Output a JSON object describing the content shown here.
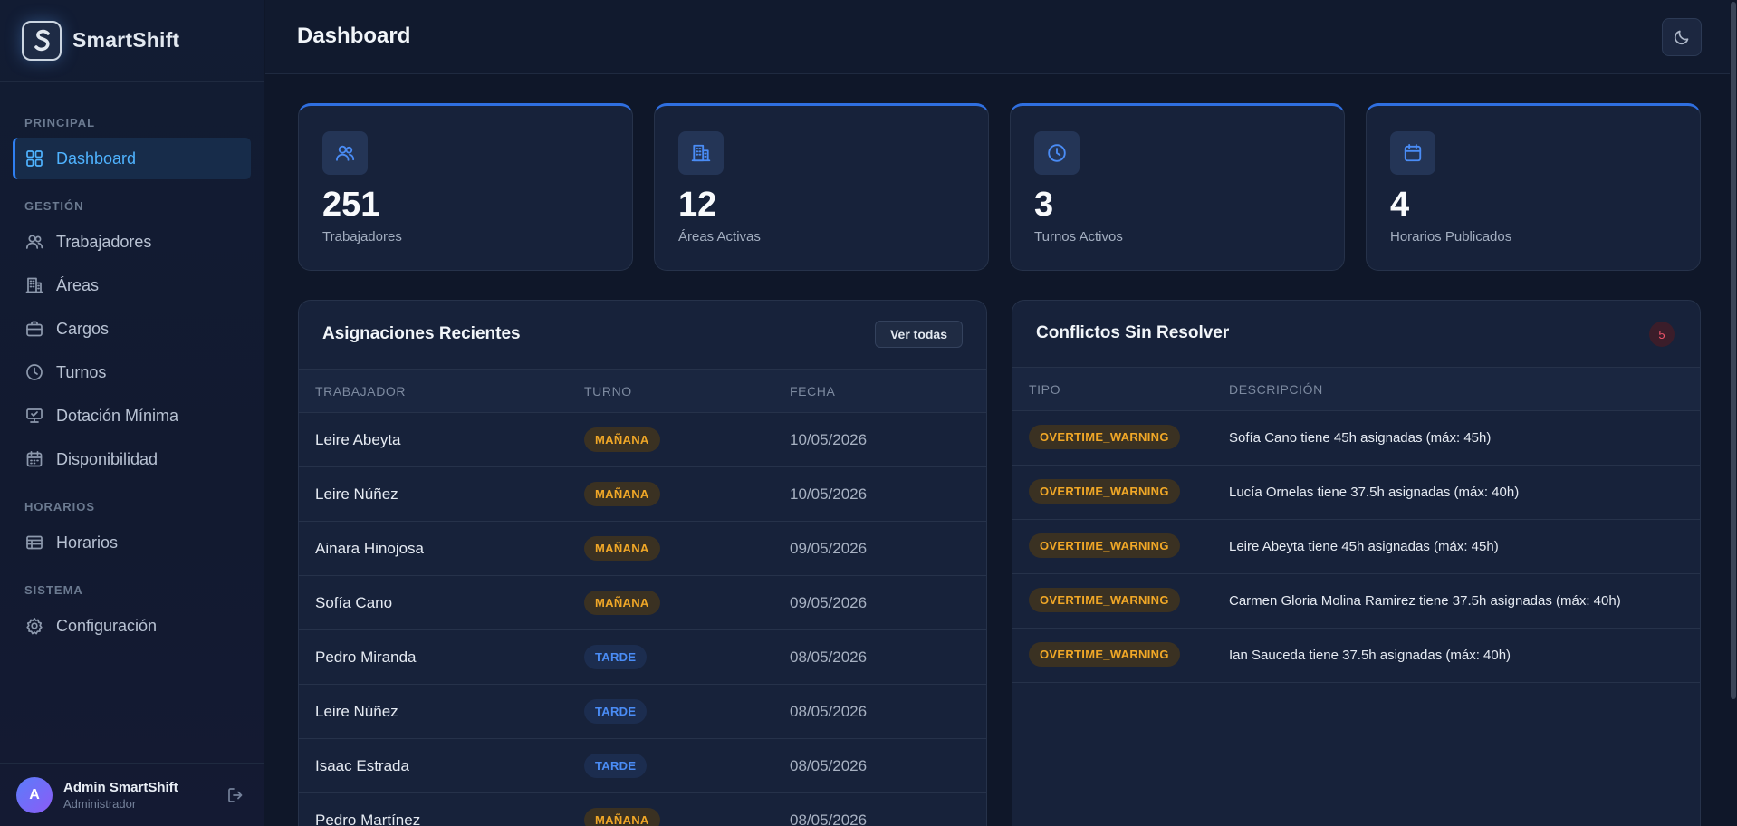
{
  "brand": {
    "name": "SmartShift"
  },
  "sidebar": {
    "sections": [
      {
        "title": "PRINCIPAL",
        "items": [
          {
            "label": "Dashboard",
            "icon": "grid-icon",
            "active": true
          }
        ]
      },
      {
        "title": "GESTIÓN",
        "items": [
          {
            "label": "Trabajadores",
            "icon": "users-icon"
          },
          {
            "label": "Áreas",
            "icon": "building-icon"
          },
          {
            "label": "Cargos",
            "icon": "briefcase-icon"
          },
          {
            "label": "Turnos",
            "icon": "clock-icon"
          },
          {
            "label": "Dotación Mínima",
            "icon": "user-check-icon"
          },
          {
            "label": "Disponibilidad",
            "icon": "calendar-icon"
          }
        ]
      },
      {
        "title": "HORARIOS",
        "items": [
          {
            "label": "Horarios",
            "icon": "table-icon"
          }
        ]
      },
      {
        "title": "SISTEMA",
        "items": [
          {
            "label": "Configuración",
            "icon": "gear-icon"
          }
        ]
      }
    ],
    "user": {
      "initial": "A",
      "name": "Admin SmartShift",
      "role": "Administrador"
    }
  },
  "header": {
    "title": "Dashboard"
  },
  "stats": [
    {
      "value": "251",
      "label": "Trabajadores",
      "icon": "users-icon"
    },
    {
      "value": "12",
      "label": "Áreas Activas",
      "icon": "building-icon"
    },
    {
      "value": "3",
      "label": "Turnos Activos",
      "icon": "clock-icon"
    },
    {
      "value": "4",
      "label": "Horarios Publicados",
      "icon": "calendar-icon"
    }
  ],
  "assignments": {
    "title": "Asignaciones Recientes",
    "button": "Ver todas",
    "columns": [
      "TRABAJADOR",
      "TURNO",
      "FECHA"
    ],
    "rows": [
      {
        "worker": "Leire Abeyta",
        "shift": "MAÑANA",
        "shift_type": "manana",
        "date": "10/05/2026"
      },
      {
        "worker": "Leire Núñez",
        "shift": "MAÑANA",
        "shift_type": "manana",
        "date": "10/05/2026"
      },
      {
        "worker": "Ainara Hinojosa",
        "shift": "MAÑANA",
        "shift_type": "manana",
        "date": "09/05/2026"
      },
      {
        "worker": "Sofía Cano",
        "shift": "MAÑANA",
        "shift_type": "manana",
        "date": "09/05/2026"
      },
      {
        "worker": "Pedro Miranda",
        "shift": "TARDE",
        "shift_type": "tarde",
        "date": "08/05/2026"
      },
      {
        "worker": "Leire Núñez",
        "shift": "TARDE",
        "shift_type": "tarde",
        "date": "08/05/2026"
      },
      {
        "worker": "Isaac Estrada",
        "shift": "TARDE",
        "shift_type": "tarde",
        "date": "08/05/2026"
      },
      {
        "worker": "Pedro Martínez",
        "shift": "MAÑANA",
        "shift_type": "manana",
        "date": "08/05/2026"
      }
    ]
  },
  "conflicts": {
    "title": "Conflictos Sin Resolver",
    "count": "5",
    "columns": [
      "TIPO",
      "DESCRIPCIÓN"
    ],
    "rows": [
      {
        "type": "OVERTIME_WARNING",
        "description": "Sofía Cano tiene 45h asignadas (máx: 45h)"
      },
      {
        "type": "OVERTIME_WARNING",
        "description": "Lucía Ornelas tiene 37.5h asignadas (máx: 40h)"
      },
      {
        "type": "OVERTIME_WARNING",
        "description": "Leire Abeyta tiene 45h asignadas (máx: 45h)"
      },
      {
        "type": "OVERTIME_WARNING",
        "description": "Carmen Gloria Molina Ramirez tiene 37.5h asignadas (máx: 40h)"
      },
      {
        "type": "OVERTIME_WARNING",
        "description": "Ian Sauceda tiene 37.5h asignadas (máx: 40h)"
      }
    ]
  },
  "colors": {
    "accent": "#2f7ff0",
    "active_text": "#4fb3ff",
    "warning": "#f0a727",
    "danger": "#f0556a"
  }
}
